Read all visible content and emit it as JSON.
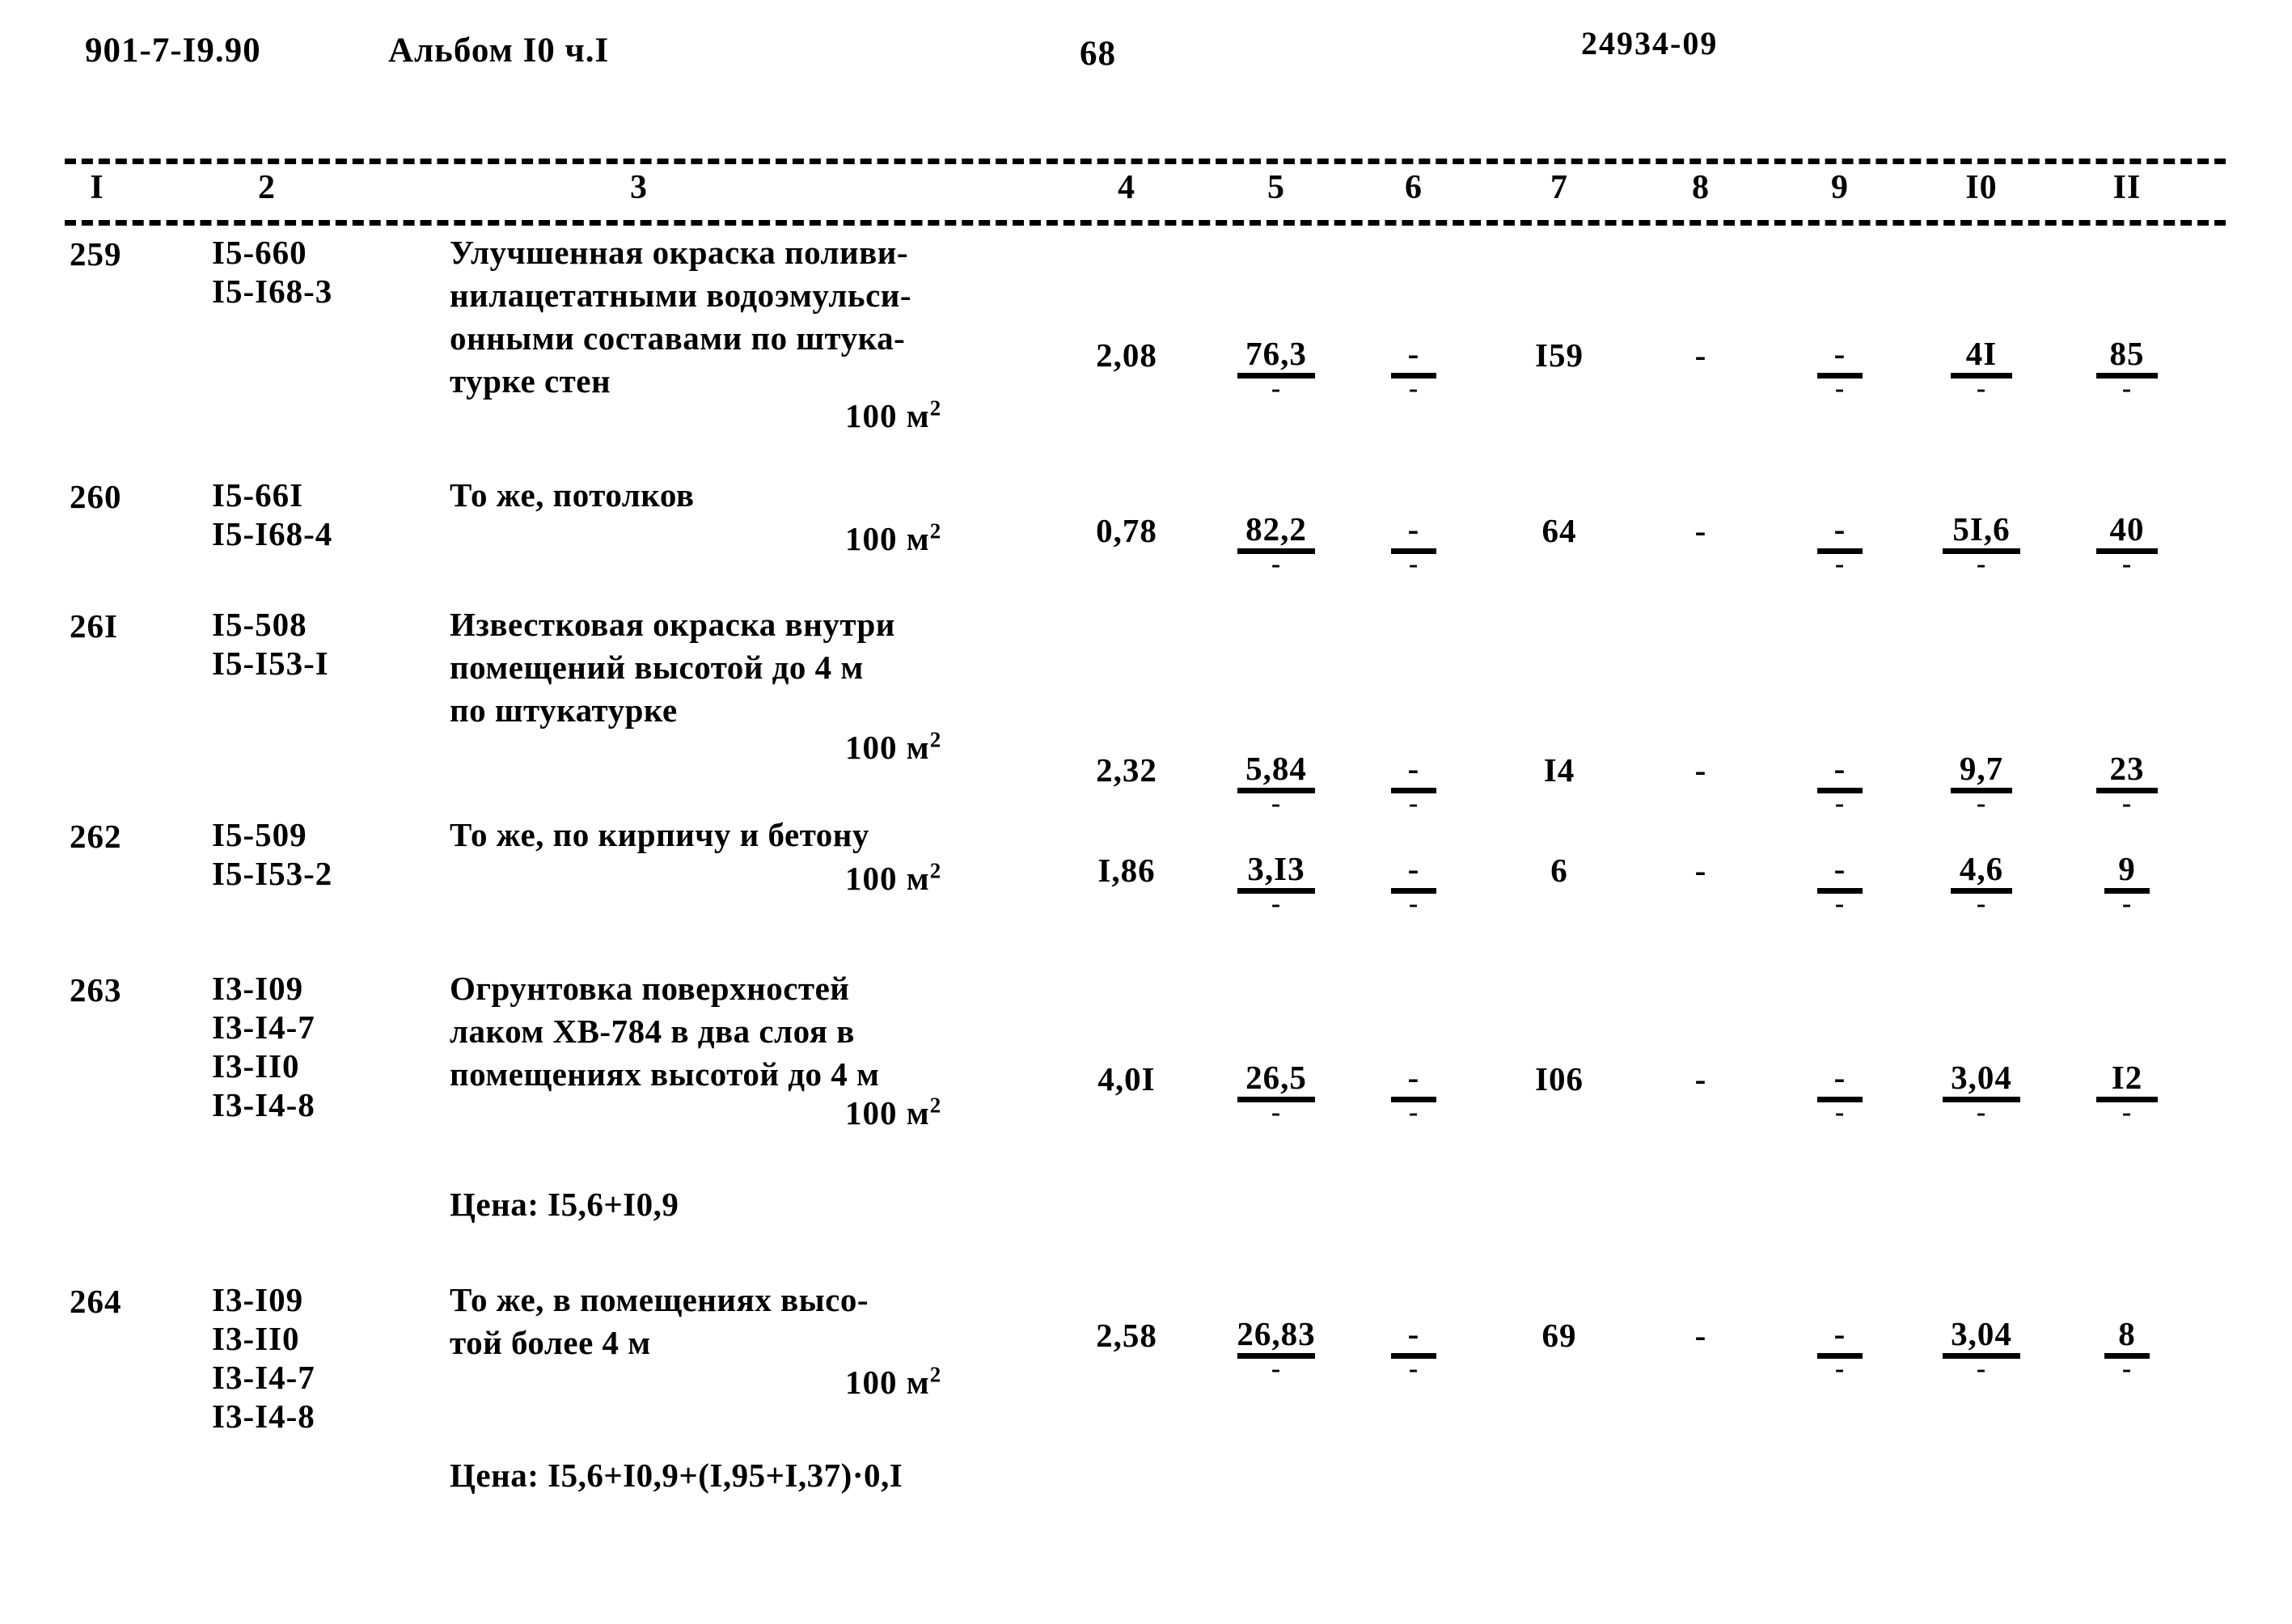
{
  "header": {
    "doc_code": "901-7-I9.90",
    "album": "Альбом I0 ч.I",
    "page_number": "68",
    "stamp": "24934-09"
  },
  "table": {
    "column_headers": [
      "I",
      "2",
      "3",
      "4",
      "5",
      "6",
      "7",
      "8",
      "9",
      "I0",
      "II"
    ],
    "rows": [
      {
        "num": "259",
        "codes": [
          "I5-660",
          "I5-I68-3"
        ],
        "desc_lines": [
          "Улучшенная окраска поливи-",
          "нилацетатными водоэмульси-",
          "онными составами по штука-",
          "турке стен"
        ],
        "unit": "100 м",
        "unit_sup": "2",
        "price_note": "",
        "c4": "2,08",
        "c5_top": "76,3",
        "c5_bot": "-",
        "c6_top": "-",
        "c6_bot": "-",
        "c7": "I59",
        "c8": "-",
        "c9_top": "-",
        "c9_bot": "-",
        "c10_top": "4I",
        "c10_bot": "-",
        "c11_top": "85",
        "c11_bot": "-"
      },
      {
        "num": "260",
        "codes": [
          "I5-66I",
          "I5-I68-4"
        ],
        "desc_lines": [
          "То же, потолков"
        ],
        "unit": "100 м",
        "unit_sup": "2",
        "price_note": "",
        "c4": "0,78",
        "c5_top": "82,2",
        "c5_bot": "-",
        "c6_top": "-",
        "c6_bot": "-",
        "c7": "64",
        "c8": "-",
        "c9_top": "-",
        "c9_bot": "-",
        "c10_top": "5I,6",
        "c10_bot": "-",
        "c11_top": "40",
        "c11_bot": "-"
      },
      {
        "num": "26I",
        "codes": [
          "I5-508",
          "I5-I53-I"
        ],
        "desc_lines": [
          "Известковая окраска внутри",
          "помещений высотой до 4 м",
          "по штукатурке"
        ],
        "unit": "100 м",
        "unit_sup": "2",
        "price_note": "",
        "c4": "2,32",
        "c5_top": "5,84",
        "c5_bot": "-",
        "c6_top": "-",
        "c6_bot": "-",
        "c7": "I4",
        "c8": "-",
        "c9_top": "-",
        "c9_bot": "-",
        "c10_top": "9,7",
        "c10_bot": "-",
        "c11_top": "23",
        "c11_bot": "-"
      },
      {
        "num": "262",
        "codes": [
          "I5-509",
          "I5-I53-2"
        ],
        "desc_lines": [
          "То же, по кирпичу и бетону"
        ],
        "unit": "100 м",
        "unit_sup": "2",
        "price_note": "",
        "c4": "I,86",
        "c5_top": "3,I3",
        "c5_bot": "-",
        "c6_top": "-",
        "c6_bot": "-",
        "c7": "6",
        "c8": "-",
        "c9_top": "-",
        "c9_bot": "-",
        "c10_top": "4,6",
        "c10_bot": "-",
        "c11_top": "9",
        "c11_bot": "-"
      },
      {
        "num": "263",
        "codes": [
          "I3-I09",
          "I3-I4-7",
          "I3-II0",
          "I3-I4-8"
        ],
        "desc_lines": [
          "Огрунтовка поверхностей",
          "лаком ХВ-784 в два слоя в",
          "помещениях высотой до 4 м"
        ],
        "unit": "100 м",
        "unit_sup": "2",
        "price_note": "Цена: I5,6+I0,9",
        "c4": "4,0I",
        "c5_top": "26,5",
        "c5_bot": "-",
        "c6_top": "-",
        "c6_bot": "-",
        "c7": "I06",
        "c8": "-",
        "c9_top": "-",
        "c9_bot": "-",
        "c10_top": "3,04",
        "c10_bot": "-",
        "c11_top": "I2",
        "c11_bot": "-"
      },
      {
        "num": "264",
        "codes": [
          "I3-I09",
          "I3-II0",
          "I3-I4-7",
          "I3-I4-8"
        ],
        "desc_lines": [
          "То же, в помещениях высо-",
          "той более 4 м"
        ],
        "unit": "100 м",
        "unit_sup": "2",
        "price_note": "Цена: I5,6+I0,9+(I,95+I,37)·0,I",
        "c4": "2,58",
        "c5_top": "26,83",
        "c5_bot": "-",
        "c6_top": "-",
        "c6_bot": "-",
        "c7": "69",
        "c8": "-",
        "c9_top": "-",
        "c9_bot": "-",
        "c10_top": "3,04",
        "c10_bot": "-",
        "c11_top": "8",
        "c11_bot": "-"
      }
    ]
  }
}
